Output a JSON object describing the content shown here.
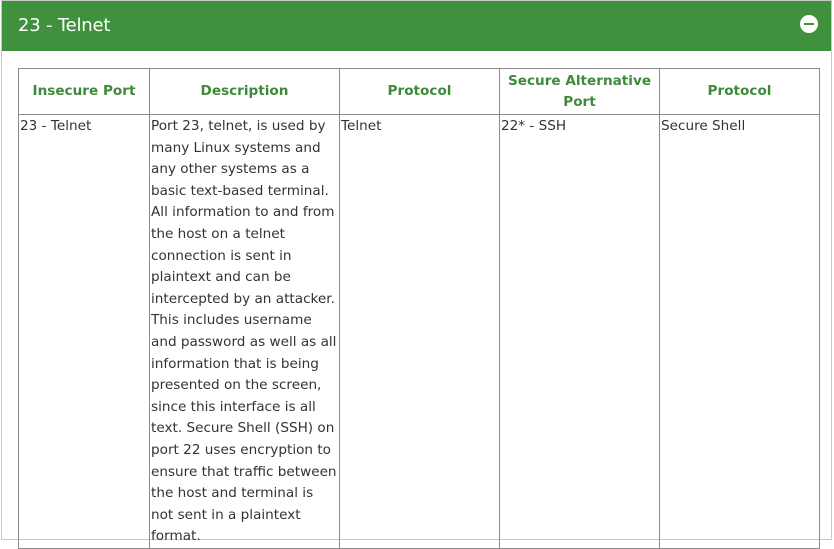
{
  "panel": {
    "title": "23 - Telnet",
    "collapse_icon": "minus-circle-icon",
    "header_color": "#3f913e"
  },
  "table": {
    "headers": [
      "Insecure Port",
      "Description",
      "Protocol",
      "Secure Alternative Port",
      "Protocol"
    ],
    "rows": [
      {
        "insecure_port": "23 - Telnet",
        "description": "Port 23, telnet, is used by many Linux systems and any other systems as a basic text-based terminal. All information to and from the host on a telnet connection is sent in plaintext and can be intercepted by an attacker. This includes username and password as well as all information that is being presented on the screen, since this interface is all text. Secure Shell (SSH) on port 22 uses encryption to ensure that traffic between the host and terminal is not sent in a plaintext format.",
        "protocol": "Telnet",
        "secure_port": "22* - SSH",
        "secure_protocol": "Secure Shell"
      }
    ]
  }
}
